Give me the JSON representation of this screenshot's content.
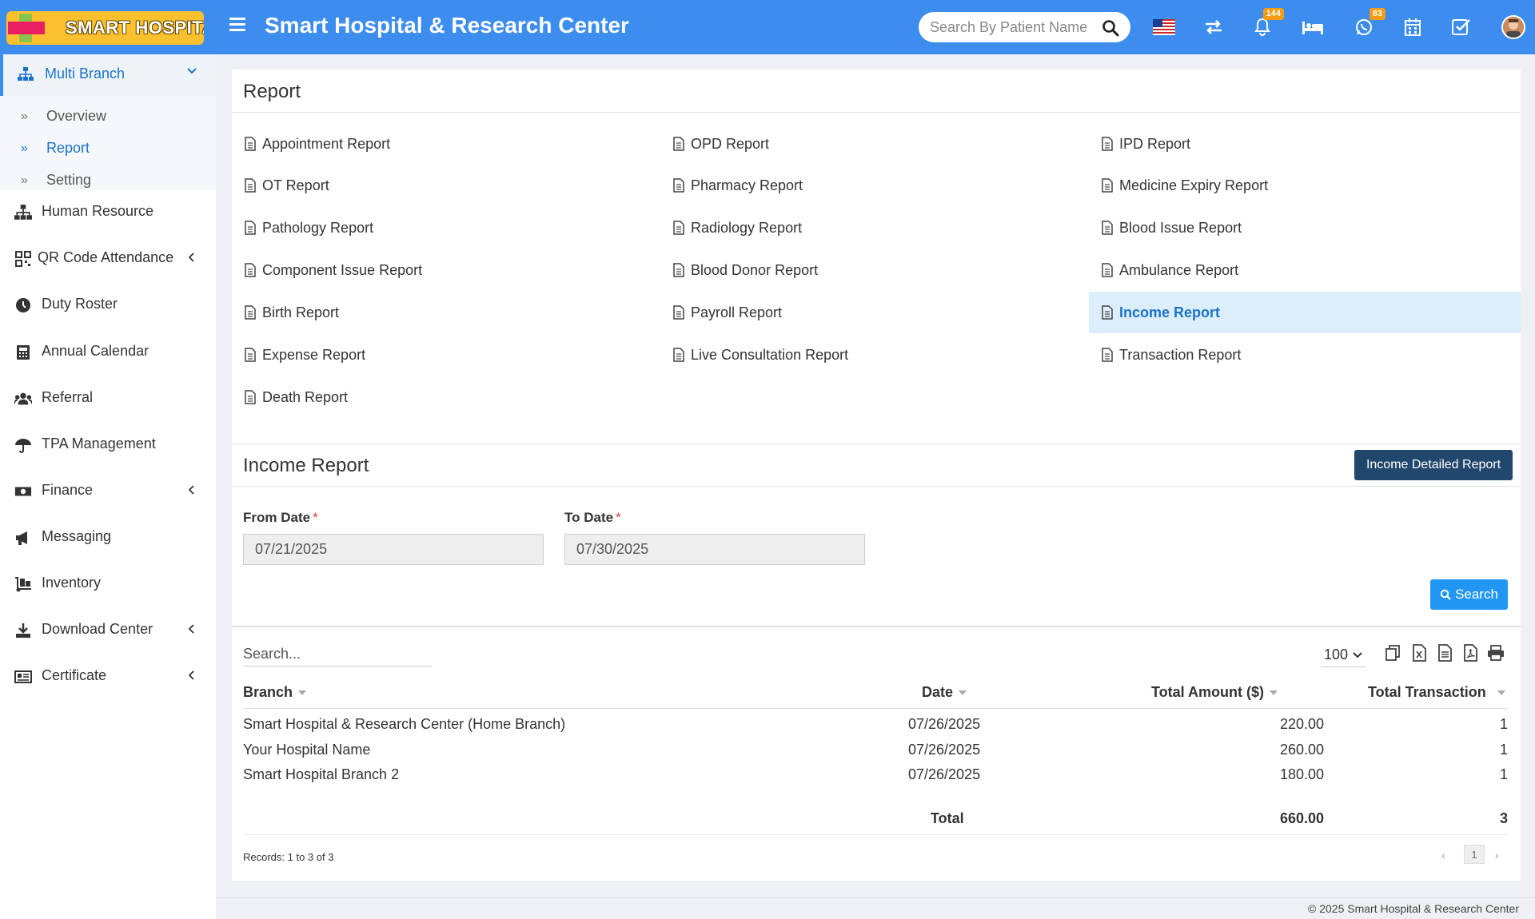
{
  "header": {
    "logo_text": "SMART HOSPITAL",
    "title": "Smart Hospital & Research Center",
    "search_placeholder": "Search By Patient Name",
    "notification_count": "144",
    "whatsapp_count": "83",
    "icons": [
      "menu-icon",
      "flag-us-icon",
      "switch-icon",
      "bell-icon",
      "bed-icon",
      "whatsapp-icon",
      "calendar-icon",
      "task-check-icon",
      "user-avatar"
    ],
    "accent_color": "#3c8dee"
  },
  "sidebar": {
    "active_group": {
      "label": "Multi Branch",
      "icon": "sitemap-icon"
    },
    "subitems": [
      {
        "label": "Overview",
        "active": false
      },
      {
        "label": "Report",
        "active": true
      },
      {
        "label": "Setting",
        "active": false
      }
    ],
    "items": [
      {
        "label": "Human Resource",
        "icon": "sitemap-icon",
        "has_children": false
      },
      {
        "label": "QR Code Attendance",
        "icon": "qrcode-icon",
        "has_children": true
      },
      {
        "label": "Duty Roster",
        "icon": "clock-icon",
        "has_children": false
      },
      {
        "label": "Annual Calendar",
        "icon": "calculator-icon",
        "has_children": false
      },
      {
        "label": "Referral",
        "icon": "users-icon",
        "has_children": false
      },
      {
        "label": "TPA Management",
        "icon": "umbrella-icon",
        "has_children": false
      },
      {
        "label": "Finance",
        "icon": "money-icon",
        "has_children": true
      },
      {
        "label": "Messaging",
        "icon": "bullhorn-icon",
        "has_children": false
      },
      {
        "label": "Inventory",
        "icon": "dolly-icon",
        "has_children": false
      },
      {
        "label": "Download Center",
        "icon": "download-icon",
        "has_children": true
      },
      {
        "label": "Certificate",
        "icon": "certificate-icon",
        "has_children": true
      }
    ]
  },
  "report_section": {
    "title": "Report",
    "links": [
      [
        "Appointment Report",
        "OPD Report",
        "IPD Report"
      ],
      [
        "OT Report",
        "Pharmacy Report",
        "Medicine Expiry Report"
      ],
      [
        "Pathology Report",
        "Radiology Report",
        "Blood Issue Report"
      ],
      [
        "Component Issue Report",
        "Blood Donor Report",
        "Ambulance Report"
      ],
      [
        "Birth Report",
        "Payroll Report",
        "Income Report"
      ],
      [
        "Expense Report",
        "Live Consultation Report",
        "Transaction Report"
      ],
      [
        "Death Report",
        "",
        ""
      ]
    ],
    "active_link": "Income Report"
  },
  "income_section": {
    "title": "Income Report",
    "detailed_button": "Income Detailed Report",
    "from_date_label": "From Date",
    "from_date_value": "07/21/2025",
    "to_date_label": "To Date",
    "to_date_value": "07/30/2025",
    "required_mark": "*",
    "search_button": "Search"
  },
  "table": {
    "search_placeholder": "Search...",
    "page_size": "100",
    "export_icons": [
      "copy-icon",
      "excel-icon",
      "csv-icon",
      "pdf-icon",
      "print-icon"
    ],
    "columns": [
      "Branch",
      "Date",
      "Total Amount ($)",
      "Total Transaction"
    ],
    "rows": [
      [
        "Smart Hospital & Research Center (Home Branch)",
        "07/26/2025",
        "220.00",
        "1"
      ],
      [
        "Your Hospital Name",
        "07/26/2025",
        "260.00",
        "1"
      ],
      [
        "Smart Hospital Branch 2",
        "07/26/2025",
        "180.00",
        "1"
      ]
    ],
    "total": {
      "label": "Total",
      "amount": "660.00",
      "transactions": "3"
    },
    "records_text": "Records: 1 to 3 of 3",
    "current_page": "1",
    "prev": "‹",
    "next": "›"
  },
  "footer": {
    "text": "© 2025 Smart Hospital & Research Center"
  }
}
